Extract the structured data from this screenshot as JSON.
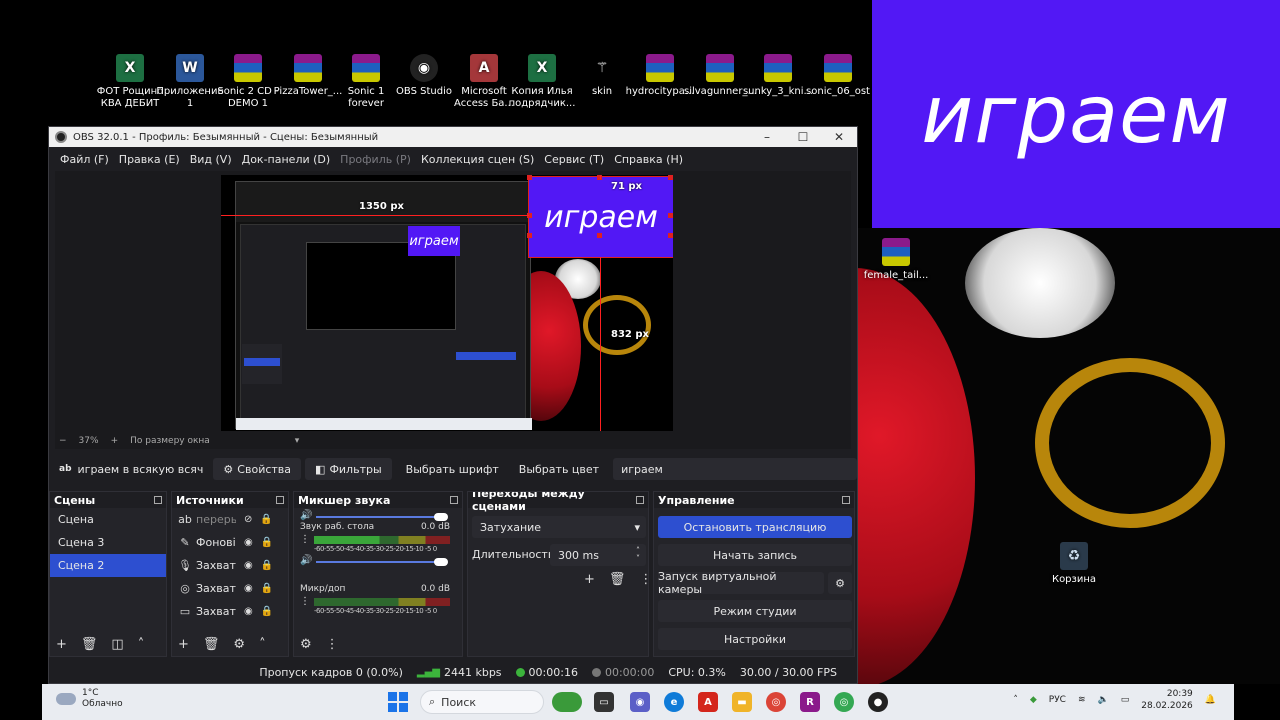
{
  "overlay": {
    "text": "играем"
  },
  "desktop_icons": [
    {
      "label": "ФОТ Рощино КВА ДЕБИТ",
      "icon": "excel-icon",
      "kind": "xls"
    },
    {
      "label": "Приложение 1",
      "icon": "word-icon",
      "kind": "doc"
    },
    {
      "label": "Sonic 2 CD - DEMO 1",
      "icon": "winrar-icon",
      "kind": "rar"
    },
    {
      "label": "PizzaTower_...",
      "icon": "winrar-icon",
      "kind": "rar"
    },
    {
      "label": "Sonic 1 forever",
      "icon": "winrar-icon",
      "kind": "rar"
    },
    {
      "label": "OBS Studio",
      "icon": "obs-icon",
      "kind": "obs"
    },
    {
      "label": "Microsoft Access Ба...",
      "icon": "access-icon",
      "kind": "acc"
    },
    {
      "label": "Копия Илья подрядчик...",
      "icon": "excel-icon",
      "kind": "xls"
    },
    {
      "label": "skin",
      "icon": "sprite-icon",
      "kind": "skin"
    },
    {
      "label": "hydrocitypa...",
      "icon": "winrar-icon",
      "kind": "rar"
    },
    {
      "label": "silvagunner_...",
      "icon": "winrar-icon",
      "kind": "rar"
    },
    {
      "label": "sunky_3_kni...",
      "icon": "winrar-icon",
      "kind": "rar"
    },
    {
      "label": "sonic_06_ost",
      "icon": "winrar-icon",
      "kind": "rar"
    },
    {
      "label": "female_tail...",
      "icon": "winrar-icon",
      "kind": "rar"
    },
    {
      "label": "Корзина",
      "icon": "recycle-bin-icon",
      "kind": "bin"
    }
  ],
  "obs": {
    "title": "OBS 32.0.1 - Профиль: Безымянный - Сцены: Безымянный",
    "menu": [
      {
        "label": "Файл (F)",
        "disabled": false
      },
      {
        "label": "Правка (E)",
        "disabled": false
      },
      {
        "label": "Вид (V)",
        "disabled": false
      },
      {
        "label": "Док-панели (D)",
        "disabled": false
      },
      {
        "label": "Профиль (P)",
        "disabled": true
      },
      {
        "label": "Коллекция сцен (S)",
        "disabled": false
      },
      {
        "label": "Сервис (T)",
        "disabled": false
      },
      {
        "label": "Справка (H)",
        "disabled": false
      }
    ],
    "preview": {
      "banner_text": "играем",
      "inner_banner_text": "играем",
      "dim_top": "71 px",
      "dim_left": "1350 px",
      "dim_bottom": "832 px"
    },
    "zoom": {
      "minus": "−",
      "value": "37%",
      "plus": "+",
      "fit": "По размеру окна"
    },
    "props_bar": {
      "source_name": "играем в всякую всяч",
      "properties": "Свойства",
      "filters": "Фильтры",
      "font": "Выбрать шрифт",
      "color": "Выбрать цвет",
      "text_value": "играем"
    },
    "scenes": {
      "title": "Сцены",
      "items": [
        {
          "label": "Сцена",
          "selected": false
        },
        {
          "label": "Сцена 3",
          "selected": false
        },
        {
          "label": "Сцена 2",
          "selected": true
        }
      ]
    },
    "sources": {
      "title": "Источники",
      "items": [
        {
          "label": "переры",
          "icon": "text-icon",
          "glyph": "ab",
          "visible": false
        },
        {
          "label": "Фонові",
          "icon": "brush-icon",
          "glyph": "✎",
          "visible": true
        },
        {
          "label": "Захват",
          "icon": "microphone-icon",
          "glyph": "🎙",
          "visible": true
        },
        {
          "label": "Захват",
          "icon": "gamepad-icon",
          "glyph": "◎",
          "visible": true
        },
        {
          "label": "Захват",
          "icon": "monitor-icon",
          "glyph": "▭",
          "visible": true
        }
      ]
    },
    "mixer": {
      "title": "Микшер звука",
      "channels": [
        {
          "name": "Звук раб. стола",
          "level": "0.0 dB",
          "scale": "-60-55-50-45-40-35-30-25-20-15-10 -5 0",
          "volume": 1.0
        },
        {
          "name": "Микр/доп",
          "level": "0.0 dB",
          "scale": "-60-55-50-45-40-35-30-25-20-15-10 -5 0",
          "volume": 1.0
        }
      ]
    },
    "transitions": {
      "title": "Переходы между сценами",
      "selected": "Затухание",
      "duration_label": "Длительность",
      "duration_value": "300 ms"
    },
    "controls": {
      "title": "Управление",
      "stop_stream": "Остановить трансляцию",
      "start_record": "Начать запись",
      "virtual_cam": "Запуск виртуальной камеры",
      "studio_mode": "Режим студии",
      "settings": "Настройки"
    },
    "status": {
      "dropped": "Пропуск кадров 0 (0.0%)",
      "bitrate": "2441 kbps",
      "stream_time": "00:00:16",
      "record_time": "00:00:00",
      "cpu": "CPU: 0.3%",
      "fps": "30.00 / 30.00 FPS",
      "bitrate_color": "#3cb43c",
      "live_color": "#3cb43c",
      "rec_color": "#777777"
    }
  },
  "taskbar": {
    "weather_temp": "1°C",
    "weather_desc": "Облачно",
    "search_placeholder": "Поиск",
    "lang": "РУС",
    "time": "20:39",
    "date": "28.02.2026"
  },
  "colors": {
    "accent": "#2d4fd0",
    "overlay_bg": "#5218f5",
    "panel": "#242429"
  }
}
